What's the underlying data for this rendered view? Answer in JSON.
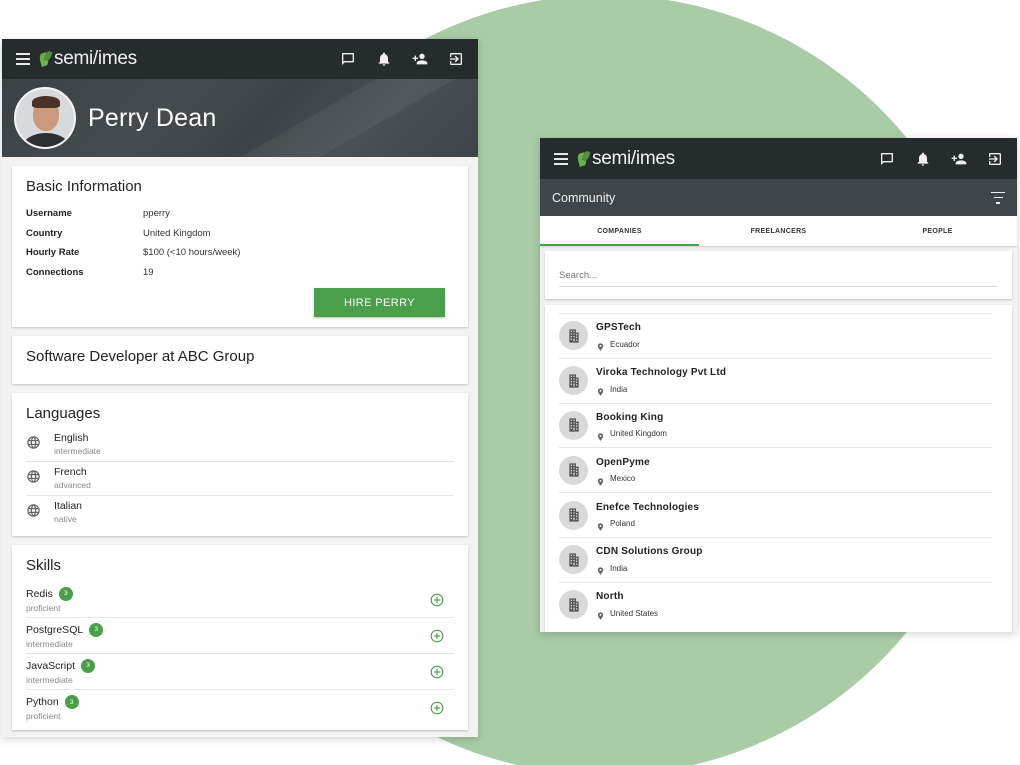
{
  "app": {
    "brand_name": "semi/imes"
  },
  "profile": {
    "name": "Perry Dean",
    "basic_info": {
      "title": "Basic Information",
      "rows": [
        {
          "label": "Username",
          "value": "pperry"
        },
        {
          "label": "Country",
          "value": "United Kingdom"
        },
        {
          "label": "Hourly Rate",
          "value": "$100 (<10 hours/week)"
        },
        {
          "label": "Connections",
          "value": "19"
        }
      ],
      "hire_button": "HIRE PERRY"
    },
    "job": "Software Developer at ABC Group",
    "languages": {
      "title": "Languages",
      "items": [
        {
          "name": "English",
          "level": "intermediate"
        },
        {
          "name": "French",
          "level": "advanced"
        },
        {
          "name": "Italian",
          "level": "native"
        }
      ]
    },
    "skills": {
      "title": "Skills",
      "items": [
        {
          "name": "Redis",
          "endorsements": "3",
          "level": "proficient"
        },
        {
          "name": "PostgreSQL",
          "endorsements": "3",
          "level": "intermediate"
        },
        {
          "name": "JavaScript",
          "endorsements": "3",
          "level": "intermediate"
        },
        {
          "name": "Python",
          "endorsements": "3",
          "level": "proficient"
        }
      ]
    }
  },
  "community": {
    "title": "Community",
    "tabs": [
      "COMPANIES",
      "FREELANCERS",
      "PEOPLE"
    ],
    "active_tab": "COMPANIES",
    "search": {
      "placeholder": "Search...",
      "value": ""
    },
    "companies": [
      {
        "name": "GPSTech",
        "country": "Ecuador"
      },
      {
        "name": "Viroka Technology Pvt Ltd",
        "country": "India"
      },
      {
        "name": "Booking King",
        "country": "United Kingdom"
      },
      {
        "name": "OpenPyme",
        "country": "Mexico"
      },
      {
        "name": "Enefce Technologies",
        "country": "Poland"
      },
      {
        "name": "CDN Solutions Group",
        "country": "India"
      },
      {
        "name": "North",
        "country": "United States"
      }
    ]
  },
  "icons": {
    "menu": "menu-icon",
    "chat": "chat-icon",
    "bell": "bell-icon",
    "add_user": "add-user-icon",
    "logout": "logout-icon",
    "globe": "globe-icon",
    "plus": "plus-circle-icon",
    "filter": "filter-icon",
    "building": "building-icon",
    "pin": "location-pin-icon"
  },
  "colors": {
    "appbar": "#262b2e",
    "accent_green": "#4aa04a",
    "background_circle": "#a9cba6"
  }
}
